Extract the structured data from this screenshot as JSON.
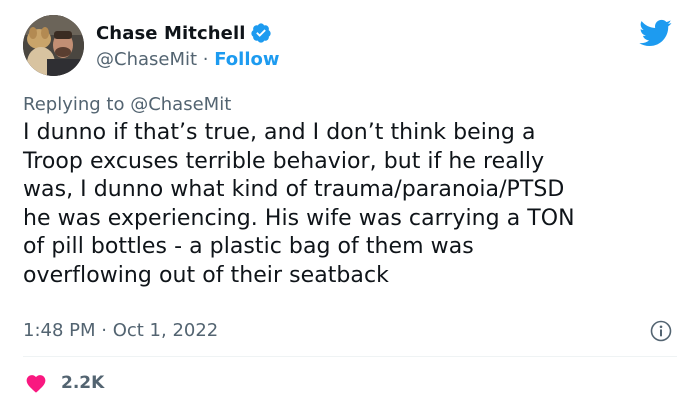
{
  "user": {
    "display_name": "Chase Mitchell",
    "handle": "@ChaseMit",
    "separator": " · ",
    "follow_label": "Follow"
  },
  "reply": {
    "prefix": "Replying to ",
    "mention": "@ChaseMit"
  },
  "tweet": {
    "lines": [
      "I dunno if that’s true, and I don’t think being a",
      "Troop excuses terrible behavior, but if he really",
      "was, I dunno what kind of trauma/paranoia/PTSD",
      "he was experiencing. His wife was carrying a TON",
      "of pill bottles - a plastic bag of them was",
      "overflowing out of their seatback"
    ]
  },
  "meta": {
    "time": "1:48 PM",
    "date_separator": " · ",
    "date": "Oct 1, 2022"
  },
  "engagement": {
    "likes": "2.2K"
  },
  "icons": {
    "verified": "verified-badge-icon",
    "brand": "twitter-bird-icon",
    "info": "info-icon",
    "like": "heart-icon"
  },
  "colors": {
    "accent": "#1d9bf0",
    "heart": "#f91880",
    "secondary_text": "#536471",
    "primary_text": "#0f1419"
  }
}
